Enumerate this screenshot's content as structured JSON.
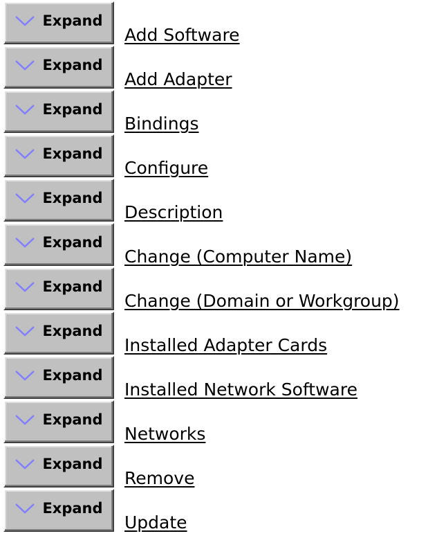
{
  "expand_button": {
    "label": "Expand",
    "icon": "chevron-down-icon"
  },
  "topics": [
    {
      "label": " Add Software"
    },
    {
      "label": " Add Adapter"
    },
    {
      "label": " Bindings"
    },
    {
      "label": " Configure"
    },
    {
      "label": " Description"
    },
    {
      "label": " Change (Computer Name)"
    },
    {
      "label": " Change (Domain or Workgroup)"
    },
    {
      "label": " Installed Adapter Cards"
    },
    {
      "label": " Installed Network Software"
    },
    {
      "label": " Networks"
    },
    {
      "label": " Remove"
    },
    {
      "label": " Update"
    }
  ],
  "colors": {
    "button_face": "#c0c0c0",
    "chevron": "#8080ff",
    "text": "#000000",
    "background": "#ffffff"
  }
}
